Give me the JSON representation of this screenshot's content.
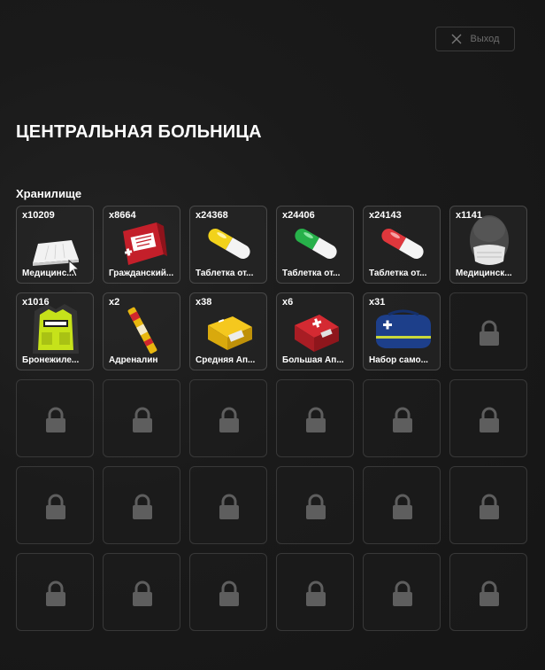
{
  "header": {
    "exit_label": "Выход"
  },
  "page": {
    "title": "ЦЕНТРАЛЬНАЯ БОЛЬНИЦА",
    "section": "Хранилище"
  },
  "items": [
    {
      "qty": "x10209",
      "name": "Медицинс...",
      "icon": "medical-sheet-icon"
    },
    {
      "qty": "x8664",
      "name": "Гражданский...",
      "icon": "first-aid-kit-icon"
    },
    {
      "qty": "x24368",
      "name": "Таблетка от...",
      "icon": "yellow-pill-icon",
      "color": "#f2d21b"
    },
    {
      "qty": "x24406",
      "name": "Таблетка от...",
      "icon": "green-pill-icon",
      "color": "#27b14a"
    },
    {
      "qty": "x24143",
      "name": "Таблетка от...",
      "icon": "red-pill-icon",
      "color": "#e0373c"
    },
    {
      "qty": "x1141",
      "name": "Медицинск...",
      "icon": "medical-mask-icon"
    },
    {
      "qty": "x1016",
      "name": "Бронежиле...",
      "icon": "medic-vest-icon"
    },
    {
      "qty": "x2",
      "name": "Адреналин",
      "icon": "adrenaline-syringe-icon"
    },
    {
      "qty": "x38",
      "name": "Средняя Ап...",
      "icon": "medium-first-aid-icon",
      "color": "#e8b70f"
    },
    {
      "qty": "x6",
      "name": "Большая Ап...",
      "icon": "large-first-aid-icon",
      "color": "#c8232c"
    },
    {
      "qty": "x31",
      "name": "Набор само...",
      "icon": "self-aid-bag-icon",
      "color": "#1d3f8a"
    }
  ],
  "slots": {
    "total": 30
  }
}
